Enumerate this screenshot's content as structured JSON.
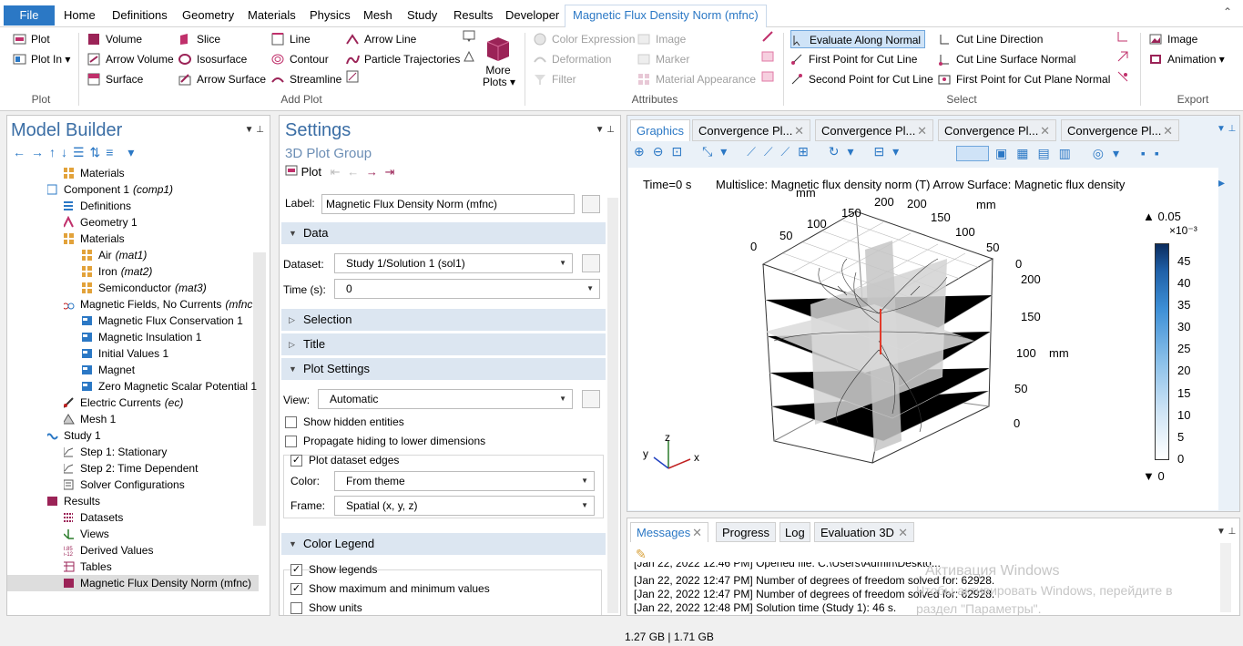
{
  "menubar": {
    "file": "File",
    "tabs": [
      "Home",
      "Definitions",
      "Geometry",
      "Materials",
      "Physics",
      "Mesh",
      "Study",
      "Results",
      "Developer"
    ],
    "context_tab": "Magnetic Flux Density Norm (mfnc)"
  },
  "ribbon": {
    "plot": {
      "plot": "Plot",
      "plot_in": "Plot In",
      "group": "Plot"
    },
    "add_plot": {
      "volume": "Volume",
      "arrow_volume": "Arrow Volume",
      "surface": "Surface",
      "slice": "Slice",
      "isosurface": "Isosurface",
      "arrow_surface": "Arrow Surface",
      "line": "Line",
      "contour": "Contour",
      "streamline": "Streamline",
      "arrow_line": "Arrow Line",
      "particle_trajectories": "Particle Trajectories",
      "more_plots_1": "More",
      "more_plots_2": "Plots",
      "group": "Add Plot"
    },
    "attributes": {
      "color_expression": "Color Expression",
      "deformation": "Deformation",
      "filter": "Filter",
      "image": "Image",
      "marker": "Marker",
      "material_appearance": "Material Appearance",
      "group": "Attributes"
    },
    "select": {
      "evaluate_along_normal": "Evaluate Along Normal",
      "first_point": "First Point for Cut Line",
      "second_point": "Second Point for Cut Line",
      "cut_line_direction": "Cut Line Direction",
      "cut_line_surface_normal": "Cut Line Surface Normal",
      "first_point_plane": "First Point for Cut Plane Normal",
      "group": "Select"
    },
    "export": {
      "image": "Image",
      "animation": "Animation",
      "group": "Export"
    }
  },
  "model_builder": {
    "title": "Model Builder",
    "items": [
      {
        "label": "Materials",
        "sub": ""
      },
      {
        "label": "Component 1",
        "sub": "(comp1)"
      },
      {
        "label": "Definitions",
        "sub": ""
      },
      {
        "label": "Geometry 1",
        "sub": ""
      },
      {
        "label": "Materials",
        "sub": ""
      },
      {
        "label": "Air",
        "sub": "(mat1)"
      },
      {
        "label": "Iron",
        "sub": "(mat2)"
      },
      {
        "label": "Semiconductor",
        "sub": "(mat3)"
      },
      {
        "label": "Magnetic Fields, No Currents",
        "sub": "(mfnc"
      },
      {
        "label": "Magnetic Flux Conservation 1",
        "sub": ""
      },
      {
        "label": "Magnetic Insulation 1",
        "sub": ""
      },
      {
        "label": "Initial Values 1",
        "sub": ""
      },
      {
        "label": "Magnet",
        "sub": ""
      },
      {
        "label": "Zero Magnetic Scalar Potential 1",
        "sub": ""
      },
      {
        "label": "Electric Currents",
        "sub": "(ec)"
      },
      {
        "label": "Mesh 1",
        "sub": ""
      },
      {
        "label": "Study 1",
        "sub": ""
      },
      {
        "label": "Step 1: Stationary",
        "sub": ""
      },
      {
        "label": "Step 2: Time Dependent",
        "sub": ""
      },
      {
        "label": "Solver Configurations",
        "sub": ""
      },
      {
        "label": "Results",
        "sub": ""
      },
      {
        "label": "Datasets",
        "sub": ""
      },
      {
        "label": "Views",
        "sub": ""
      },
      {
        "label": "Derived Values",
        "sub": ""
      },
      {
        "label": "Tables",
        "sub": ""
      },
      {
        "label": "Magnetic Flux Density Norm (mfnc)",
        "sub": ""
      }
    ]
  },
  "settings": {
    "title": "Settings",
    "subtitle": "3D Plot Group",
    "plot_btn": "Plot",
    "label_caption": "Label:",
    "label_value": "Magnetic Flux Density Norm (mfnc)",
    "data_section": "Data",
    "dataset_caption": "Dataset:",
    "dataset_value": "Study 1/Solution 1 (sol1)",
    "time_caption": "Time (s):",
    "time_value": "0",
    "selection_section": "Selection",
    "title_section": "Title",
    "plot_settings_section": "Plot Settings",
    "view_caption": "View:",
    "view_value": "Automatic",
    "show_hidden": "Show hidden entities",
    "propagate": "Propagate hiding to lower dimensions",
    "plot_dataset_edges": "Plot dataset edges",
    "color_caption": "Color:",
    "color_value": "From theme",
    "frame_caption": "Frame:",
    "frame_value": "Spatial  (x, y, z)",
    "color_legend_section": "Color Legend",
    "show_legends": "Show legends",
    "show_maxmin": "Show maximum and minimum values",
    "show_units": "Show units"
  },
  "graphics": {
    "tabs": [
      "Graphics",
      "Convergence Pl...",
      "Convergence Pl...",
      "Convergence Pl...",
      "Convergence Pl..."
    ],
    "time_text": "Time=0 s",
    "plot_title": "Multislice: Magnetic flux density norm (T)  Arrow Surface: Magnetic flux density",
    "axis_top_left": [
      "0",
      "50",
      "100",
      "150",
      "200"
    ],
    "axis_top_right": [
      "200",
      "150",
      "100",
      "50",
      "0"
    ],
    "axis_right": [
      "200",
      "150",
      "100",
      "50",
      "0"
    ],
    "unit_mm": "mm",
    "triad": {
      "x": "x",
      "y": "y",
      "z": "z"
    },
    "legend": {
      "max": "0.05",
      "exp": "×10⁻³",
      "ticks": [
        "45",
        "40",
        "35",
        "30",
        "25",
        "20",
        "15",
        "10",
        "5",
        "0"
      ],
      "min": "0",
      "max_marker": "▲",
      "min_marker": "▼"
    }
  },
  "messages": {
    "tabs": [
      "Messages",
      "Progress",
      "Log",
      "Evaluation 3D"
    ],
    "lines": [
      "[Jan 22, 2022 12:46 PM] Opened file: C:\\Users\\Admin\\Deskto...",
      "[Jan 22, 2022 12:47 PM] Number of degrees of freedom solved for: 62928.",
      "[Jan 22, 2022 12:47 PM] Number of degrees of freedom solved for: 62928.",
      "[Jan 22, 2022 12:48 PM] Solution time (Study 1): 46 s."
    ],
    "watermark_1": "Активация Windows",
    "watermark_2": "Чтобы активировать Windows, перейдите в",
    "watermark_3": "раздел \"Параметры\"."
  },
  "status": {
    "memory": "1.27 GB | 1.71 GB"
  },
  "colors": {
    "accent": "#2b78c5",
    "section_bg": "#dce6f1"
  }
}
